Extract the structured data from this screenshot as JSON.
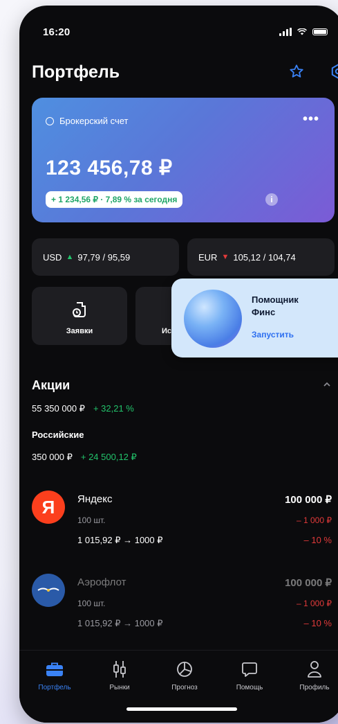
{
  "status_bar": {
    "time": "16:20"
  },
  "header": {
    "title": "Портфель",
    "star_icon": "star-icon",
    "settings_icon": "gear-icon"
  },
  "account_card": {
    "account_name": "Брокерский счет",
    "balance": "123 456,78 ₽",
    "change_today": "+ 1 234,56 ₽ · 7,89 % за сегодня"
  },
  "rates": [
    {
      "currency": "USD",
      "direction": "up",
      "value": "97,79 / 95,59"
    },
    {
      "currency": "EUR",
      "direction": "down",
      "value": "105,12 / 104,74"
    }
  ],
  "actions": [
    {
      "label": "Заявки",
      "icon": "orders-icon"
    },
    {
      "label": "Ис",
      "icon": "history-icon"
    }
  ],
  "assistant": {
    "title": "Помощник Финс",
    "cta": "Запустить"
  },
  "stocks_section": {
    "title": "Акции",
    "total": "55 350 000 ₽",
    "total_change": "+ 32,21 %",
    "group_name": "Российские",
    "group_total": "350 000 ₽",
    "group_change": "+ 24 500,12 ₽"
  },
  "stocks": [
    {
      "name": "Яндекс",
      "qty": "100 шт.",
      "price_change": "1 015,92 ₽ → 1000 ₽",
      "value": "100 000 ₽",
      "delta_abs": "– 1 000 ₽",
      "delta_pct": "– 10 %",
      "logo_color": "#fc3f1d",
      "logo_letter": "Я"
    },
    {
      "name": "Аэрофлот",
      "qty": "100 шт.",
      "price_change": "1 015,92 ₽ → 1000 ₽",
      "value": "100 000 ₽",
      "delta_abs": "– 1 000 ₽",
      "delta_pct": "– 10 %",
      "logo_color": "#2a5aa8"
    }
  ],
  "tabbar": [
    {
      "label": "Портфель",
      "icon": "briefcase-icon",
      "active": true
    },
    {
      "label": "Рынки",
      "icon": "candles-icon",
      "active": false
    },
    {
      "label": "Прогноз",
      "icon": "pie-icon",
      "active": false
    },
    {
      "label": "Помощь",
      "icon": "chat-icon",
      "active": false
    },
    {
      "label": "Профиль",
      "icon": "person-icon",
      "active": false
    }
  ],
  "colors": {
    "accent": "#3a82f5",
    "positive": "#22c36b",
    "negative": "#e23a3a",
    "assistant_bg": "#d3e7fb"
  }
}
